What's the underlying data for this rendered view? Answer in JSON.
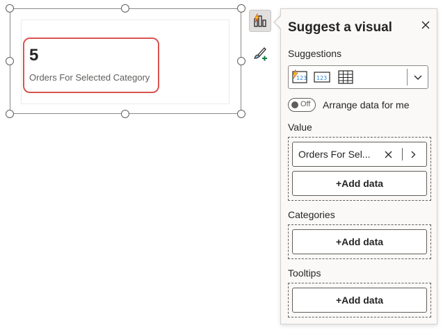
{
  "card": {
    "value": "5",
    "label": "Orders For Selected Category"
  },
  "toolbar": {
    "build_icon": "build-visual-icon",
    "format_icon": "format-paintbrush-icon"
  },
  "pane": {
    "title": "Suggest a visual",
    "close_icon": "close-icon",
    "suggestions_label": "Suggestions",
    "suggestions": [
      {
        "icon": "card-suggestion-icon",
        "glyph": "123",
        "selected": true
      },
      {
        "icon": "multirow-card-icon",
        "glyph": "123",
        "selected": false
      },
      {
        "icon": "table-visual-icon",
        "glyph": "",
        "selected": false
      }
    ],
    "toggle": {
      "state_text": "Off",
      "label": "Arrange data for me",
      "on": false
    },
    "value_section": {
      "label": "Value",
      "field": "Orders For Sel...",
      "add_label": "+Add data"
    },
    "categories_section": {
      "label": "Categories",
      "add_label": "+Add data"
    },
    "tooltips_section": {
      "label": "Tooltips",
      "add_label": "+Add data"
    }
  },
  "colors": {
    "highlight_border": "#d9534f",
    "pane_background": "#faf9f8",
    "accent_yellow": "#f2c811",
    "accent_blue": "#2b88d8"
  }
}
